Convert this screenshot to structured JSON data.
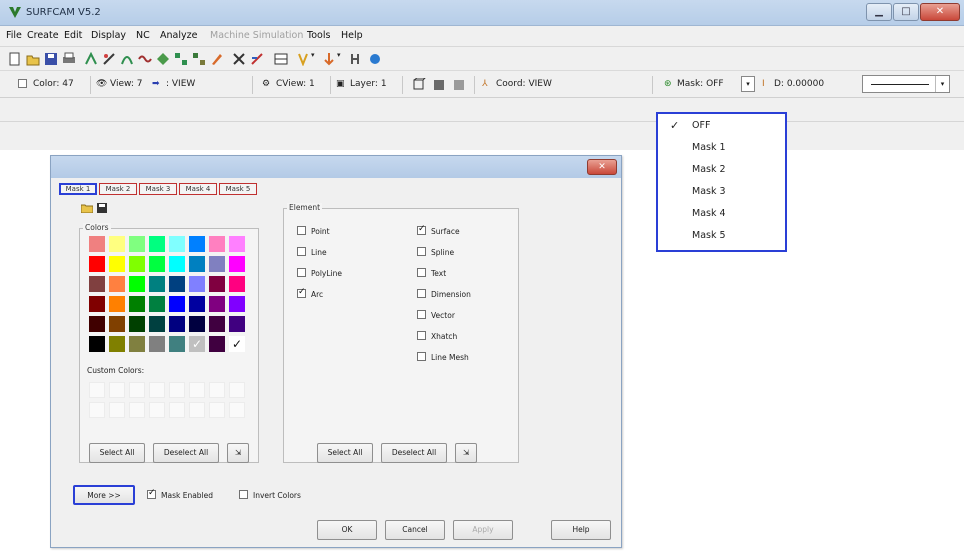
{
  "app": {
    "title": "SURFCAM V5.2"
  },
  "menu": [
    "File",
    "Create",
    "Edit",
    "Display",
    "NC",
    "Analyze",
    "Machine Simulation",
    "Tools",
    "Help"
  ],
  "toolbar_status": {
    "color": "Color: 47",
    "view": "View: 7",
    "view_name": ": VIEW",
    "cview": "CView: 1",
    "layer": "Layer: 1",
    "coord": "Coord: VIEW",
    "mask": "Mask: OFF",
    "depth": "D: 0.00000"
  },
  "mask_dropdown": {
    "options": [
      "OFF",
      "Mask 1",
      "Mask 2",
      "Mask 3",
      "Mask 4",
      "Mask 5"
    ],
    "checkmark": "✓"
  },
  "dialog": {
    "tabs": [
      "Mask 1",
      "Mask 2",
      "Mask 3",
      "Mask 4",
      "Mask 5"
    ],
    "colors_label": "Colors",
    "custom_colors_label": "Custom Colors:",
    "element_label": "Element",
    "elements_left": [
      {
        "label": "Point",
        "checked": false
      },
      {
        "label": "Line",
        "checked": false
      },
      {
        "label": "PolyLine",
        "checked": false
      },
      {
        "label": "Arc",
        "checked": true
      }
    ],
    "elements_right": [
      {
        "label": "Surface",
        "checked": true
      },
      {
        "label": "Spline",
        "checked": false
      },
      {
        "label": "Text",
        "checked": false
      },
      {
        "label": "Dimension",
        "checked": false
      },
      {
        "label": "Vector",
        "checked": false
      },
      {
        "label": "Xhatch",
        "checked": false
      },
      {
        "label": "Line Mesh",
        "checked": false
      }
    ],
    "select_all": "Select All",
    "deselect_all": "Deselect All",
    "more": "More >>",
    "mask_enabled": "Mask Enabled",
    "invert_colors": "Invert Colors",
    "ok": "OK",
    "cancel": "Cancel",
    "apply": "Apply",
    "help": "Help",
    "palette": [
      [
        "#f08080",
        "#ffff80",
        "#80ff80",
        "#00ff80",
        "#80ffff",
        "#0080ff",
        "#ff80c0",
        "#ff80ff"
      ],
      [
        "#ff0000",
        "#ffff00",
        "#80ff00",
        "#00ff40",
        "#00ffff",
        "#0080c0",
        "#8080c0",
        "#ff00ff"
      ],
      [
        "#804040",
        "#ff8040",
        "#00ff00",
        "#008080",
        "#004080",
        "#8080ff",
        "#800040",
        "#ff0080"
      ],
      [
        "#800000",
        "#ff8000",
        "#008000",
        "#008040",
        "#0000ff",
        "#0000a0",
        "#800080",
        "#8000ff"
      ],
      [
        "#400000",
        "#804000",
        "#004000",
        "#004040",
        "#000080",
        "#000040",
        "#400040",
        "#400080"
      ],
      [
        "#000000",
        "#808000",
        "#808040",
        "#808080",
        "#408080",
        "#c0c0c0",
        "#400040",
        "#ffffff"
      ]
    ]
  }
}
